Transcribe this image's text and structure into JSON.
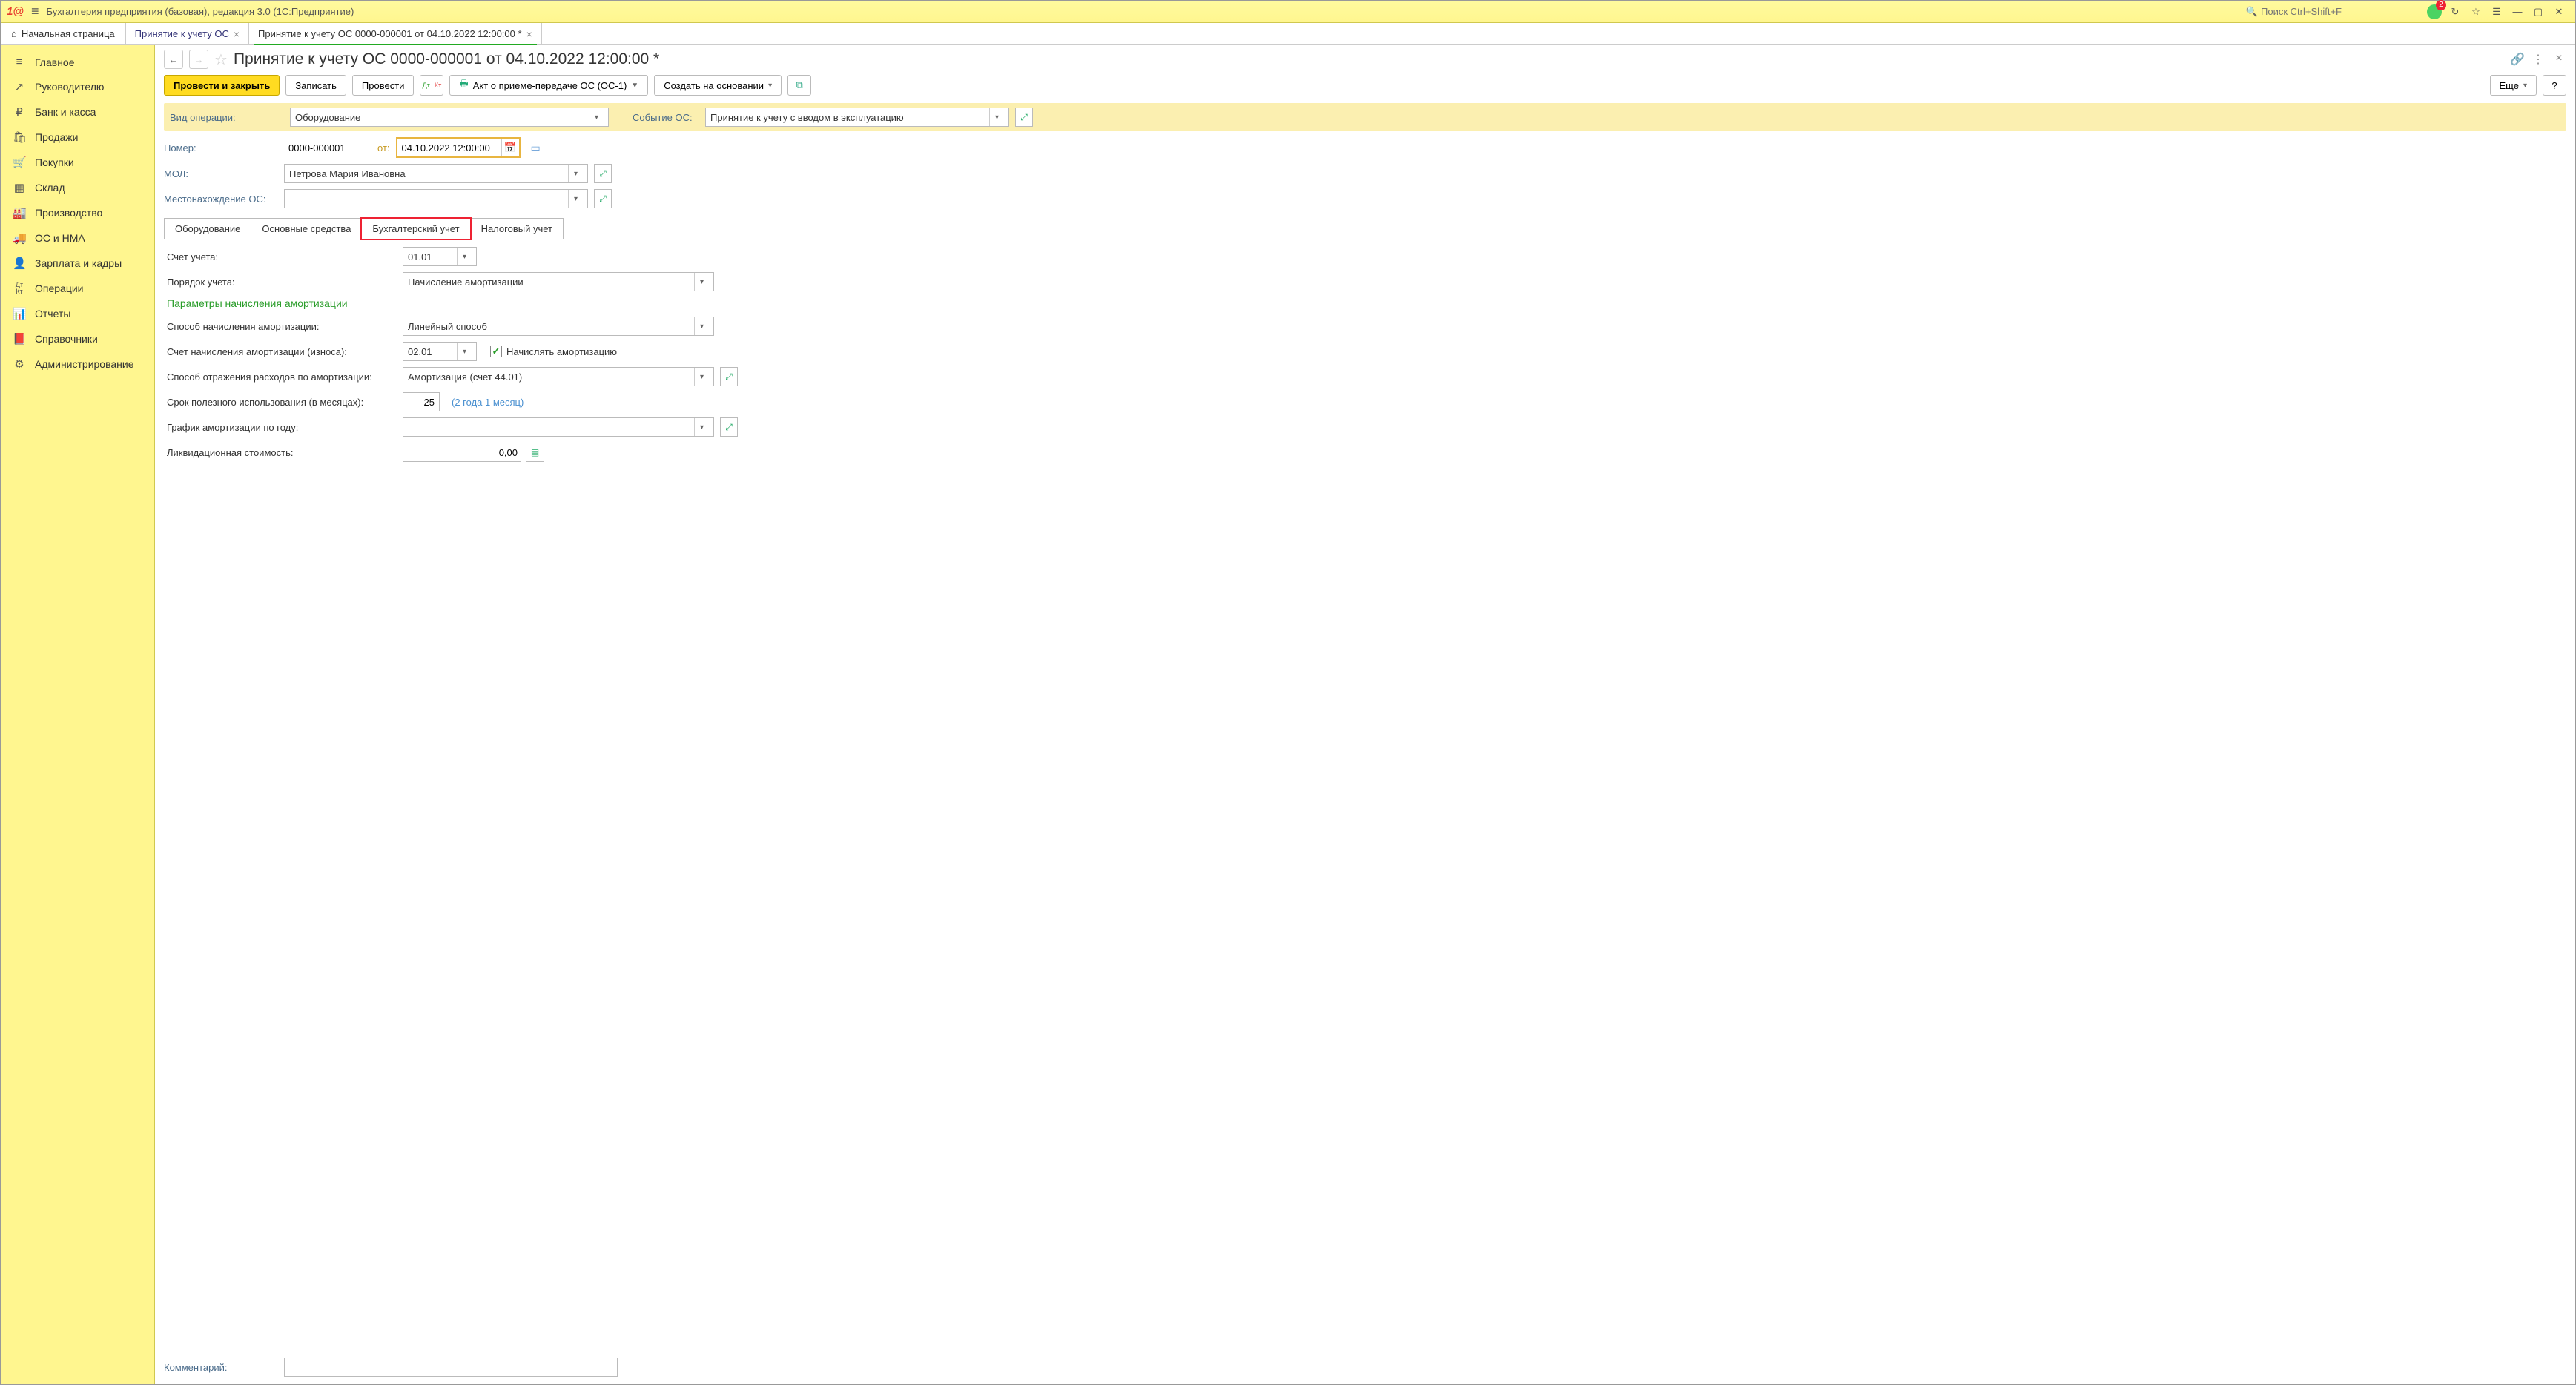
{
  "window": {
    "title": "Бухгалтерия предприятия (базовая), редакция 3.0  (1С:Предприятие)",
    "search_placeholder": "Поиск Ctrl+Shift+F",
    "notifications_count": "2"
  },
  "tabs": {
    "home": "Начальная страница",
    "t1": "Принятие к учету ОС",
    "t2": "Принятие к учету ОС 0000-000001 от 04.10.2022 12:00:00 *"
  },
  "sidebar": [
    {
      "icon": "≡",
      "label": "Главное"
    },
    {
      "icon": "↗",
      "label": "Руководителю"
    },
    {
      "icon": "₽",
      "label": "Банк и касса"
    },
    {
      "icon": "🛍",
      "label": "Продажи"
    },
    {
      "icon": "🛒",
      "label": "Покупки"
    },
    {
      "icon": "▦",
      "label": "Склад"
    },
    {
      "icon": "🏭",
      "label": "Производство"
    },
    {
      "icon": "🚚",
      "label": "ОС и НМА"
    },
    {
      "icon": "👤",
      "label": "Зарплата и кадры"
    },
    {
      "icon": "Дт Кт",
      "label": "Операции"
    },
    {
      "icon": "📊",
      "label": "Отчеты"
    },
    {
      "icon": "📕",
      "label": "Справочники"
    },
    {
      "icon": "⚙",
      "label": "Администрирование"
    }
  ],
  "page": {
    "title": "Принятие к учету ОС 0000-000001 от 04.10.2022 12:00:00 *"
  },
  "toolbar": {
    "post_close": "Провести и закрыть",
    "save": "Записать",
    "post": "Провести",
    "print": "Акт о приеме-передаче ОС (ОС-1)",
    "create_based": "Создать на основании",
    "more": "Еще",
    "help": "?"
  },
  "form": {
    "op_type_label": "Вид операции:",
    "op_type_value": "Оборудование",
    "event_label": "Событие ОС:",
    "event_value": "Принятие к учету с вводом в эксплуатацию",
    "number_label": "Номер:",
    "number_value": "0000-000001",
    "from_label": "от:",
    "date_value": "04.10.2022 12:00:00",
    "mol_label": "МОЛ:",
    "mol_value": "Петрова Мария Ивановна",
    "location_label": "Местонахождение ОС:",
    "location_value": ""
  },
  "inner_tabs": {
    "t1": "Оборудование",
    "t2": "Основные средства",
    "t3": "Бухгалтерский учет",
    "t4": "Налоговый учет"
  },
  "accounting": {
    "account_label": "Счет учета:",
    "account_value": "01.01",
    "order_label": "Порядок учета:",
    "order_value": "Начисление амортизации",
    "section_title": "Параметры начисления амортизации",
    "method_label": "Способ начисления амортизации:",
    "method_value": "Линейный способ",
    "dep_account_label": "Счет начисления амортизации (износа):",
    "dep_account_value": "02.01",
    "calc_dep_label": "Начислять амортизацию",
    "expense_label": "Способ отражения расходов по амортизации:",
    "expense_value": "Амортизация (счет 44.01)",
    "useful_life_label": "Срок полезного использования (в месяцах):",
    "useful_life_value": "25",
    "useful_life_hint": "(2 года 1 месяц)",
    "schedule_label": "График амортизации по году:",
    "schedule_value": "",
    "liquidation_label": "Ликвидационная стоимость:",
    "liquidation_value": "0,00"
  },
  "comment": {
    "label": "Комментарий:",
    "value": ""
  }
}
